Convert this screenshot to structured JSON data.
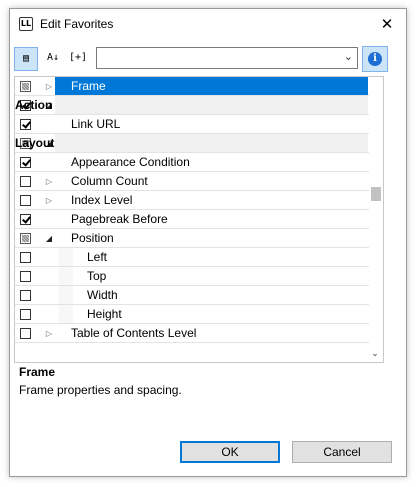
{
  "window": {
    "title": "Edit Favorites",
    "app_icon_text": "LL",
    "close_glyph": "✕"
  },
  "toolbar": {
    "categorized_glyph": "▤",
    "sort_glyph": "A↓",
    "expand_glyph": "[+]",
    "search_value": "",
    "dropdown_glyph": "⌄",
    "info_glyph": "i"
  },
  "rows": [
    {
      "label": "Frame",
      "kind": "top",
      "check": "indeterminate",
      "expander": "collapsed",
      "selected": true
    },
    {
      "label": "Action",
      "kind": "category",
      "check": "checked",
      "expander": "expanded"
    },
    {
      "label": "Link URL",
      "kind": "top",
      "check": "checked",
      "expander": "none"
    },
    {
      "label": "Layout",
      "kind": "category",
      "check": "indeterminate",
      "expander": "expanded"
    },
    {
      "label": "Appearance Condition",
      "kind": "top",
      "check": "checked",
      "expander": "none"
    },
    {
      "label": "Column Count",
      "kind": "top",
      "check": "unchecked",
      "expander": "collapsed"
    },
    {
      "label": "Index Level",
      "kind": "top",
      "check": "unchecked",
      "expander": "collapsed"
    },
    {
      "label": "Pagebreak Before",
      "kind": "top",
      "check": "checked",
      "expander": "none"
    },
    {
      "label": "Position",
      "kind": "top",
      "check": "indeterminate",
      "expander": "expanded"
    },
    {
      "label": "Left",
      "kind": "child",
      "check": "unchecked",
      "expander": "none"
    },
    {
      "label": "Top",
      "kind": "child",
      "check": "unchecked",
      "expander": "none"
    },
    {
      "label": "Width",
      "kind": "child",
      "check": "unchecked",
      "expander": "none"
    },
    {
      "label": "Height",
      "kind": "child",
      "check": "unchecked",
      "expander": "none"
    },
    {
      "label": "Table of Contents Level",
      "kind": "top",
      "check": "unchecked",
      "expander": "collapsed"
    }
  ],
  "scrollbar": {
    "down_glyph": "⌄"
  },
  "description": {
    "title": "Frame",
    "text": "Frame properties and spacing."
  },
  "buttons": {
    "ok": "OK",
    "cancel": "Cancel"
  }
}
